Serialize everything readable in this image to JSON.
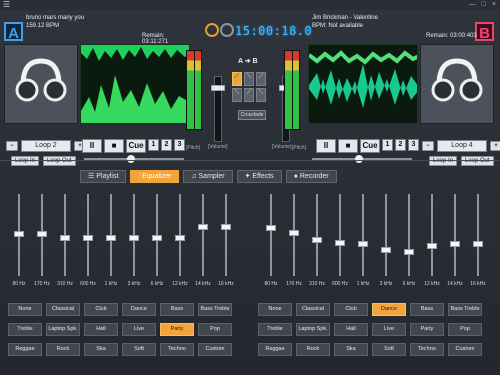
{
  "deckA": {
    "track": "bruno mars many you",
    "bpm": "159.12 BPM",
    "remain": "Remain: 03:11:271",
    "badge": "A",
    "loop": "Loop 2",
    "loop_in": "Loop In",
    "loop_out": "Loop Out"
  },
  "deckB": {
    "track": "Jim Brickman - Valentine",
    "bpm": "BPM: Not available",
    "remain": "Remain: 03:00:403",
    "badge": "B",
    "loop": "Loop 4",
    "loop_in": "Loop In",
    "loop_out": "Loop Out"
  },
  "center": {
    "time": "15:00:18.0",
    "crossfade": "Crossfade",
    "volume_left": "[Volume]",
    "volume_right": "[Volume]",
    "ab": "A ➔ B",
    "pitch_left": "[Pitch]",
    "pitch_right": "[Pitch]"
  },
  "transport": {
    "play": "II",
    "stop": "■",
    "cue": "Cue",
    "one": "1",
    "two": "2",
    "three": "3"
  },
  "tabs": [
    {
      "label": "Playlist"
    },
    {
      "label": "Equalizer"
    },
    {
      "label": "Sampler"
    },
    {
      "label": "Effects"
    },
    {
      "label": "Recorder"
    }
  ],
  "eq": {
    "bands": [
      "80 Hz",
      "170 Hz",
      "310 Hz",
      "600 Hz",
      "1 kHz",
      "3 kHz",
      "6 kHz",
      "12 kHz",
      "14 kHz",
      "16 kHz"
    ],
    "left_levels": [
      0.5,
      0.5,
      0.45,
      0.45,
      0.45,
      0.45,
      0.45,
      0.45,
      0.6,
      0.6
    ],
    "right_levels": [
      0.58,
      0.52,
      0.42,
      0.38,
      0.36,
      0.28,
      0.26,
      0.34,
      0.36,
      0.36
    ]
  },
  "presets": [
    [
      "None",
      "Classical",
      "Club",
      "Dance",
      "Bass",
      "Bass Treble"
    ],
    [
      "Treble",
      "Laptop Spk.",
      "Hall",
      "Live",
      "Party",
      "Pop"
    ],
    [
      "Reggae",
      "Rock",
      "Ska",
      "Soft",
      "Techno",
      "Custom"
    ]
  ],
  "active_presets": {
    "left": "Party",
    "right": "Dance"
  },
  "colors": {
    "accent": "#f2a43b",
    "blue": "#3ea0ef",
    "pink": "#f0426a"
  }
}
